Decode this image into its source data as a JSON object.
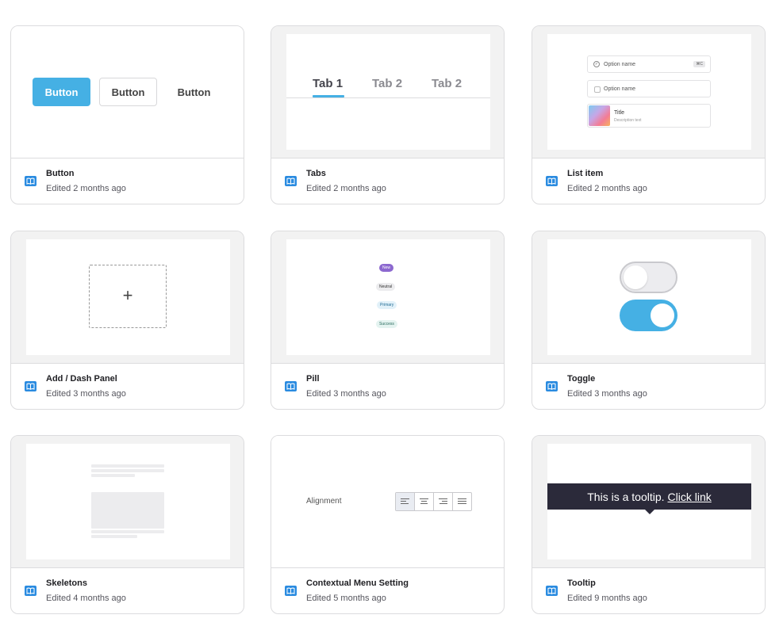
{
  "cards": [
    {
      "title": "Button",
      "edited": "Edited 2 months ago",
      "preview": {
        "primary": "Button",
        "outline": "Button",
        "text": "Button",
        "primary_color": "#45b0e4"
      }
    },
    {
      "title": "Tabs",
      "edited": "Edited 2 months ago",
      "preview": {
        "tabs": [
          "Tab 1",
          "Tab 2",
          "Tab 2"
        ],
        "active_index": 0
      }
    },
    {
      "title": "List item",
      "edited": "Edited 2 months ago",
      "preview": {
        "item1": "Option name",
        "shortcut": "⌘C",
        "item2": "Option name",
        "item3_title": "Title",
        "item3_desc": "Description text"
      }
    },
    {
      "title": "Add / Dash Panel",
      "edited": "Edited 3 months ago",
      "preview": {
        "plus": "+"
      }
    },
    {
      "title": "Pill",
      "edited": "Edited 3 months ago",
      "preview": {
        "pills": [
          "New",
          "Neutral",
          "Primary",
          "Success"
        ]
      }
    },
    {
      "title": "Toggle",
      "edited": "Edited 3 months ago",
      "preview": {
        "toggle_off": false,
        "toggle_on": true
      }
    },
    {
      "title": "Skeletons",
      "edited": "Edited 4 months ago",
      "preview": {}
    },
    {
      "title": "Contextual Menu Setting",
      "edited": "Edited 5 months ago",
      "preview": {
        "label": "Alignment",
        "options": [
          "align-left",
          "align-center",
          "align-right",
          "align-justify"
        ],
        "selected": "align-left"
      }
    },
    {
      "title": "Tooltip",
      "edited": "Edited 9 months ago",
      "preview": {
        "text": "This is a tooltip.",
        "link": "Click link"
      }
    }
  ],
  "colors": {
    "accent": "#45b0e4",
    "book_icon": "#2a8be0",
    "tooltip_bg": "#2b2a3a"
  }
}
